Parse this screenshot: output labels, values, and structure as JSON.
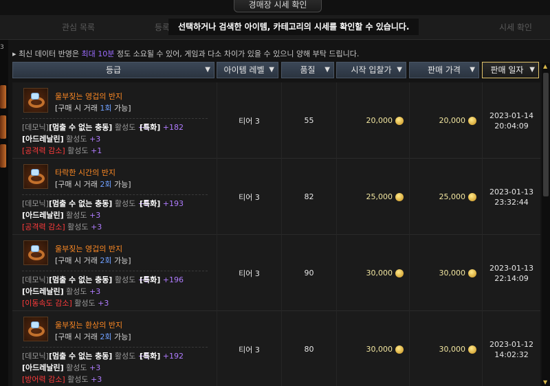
{
  "window": {
    "title": "경매장 시세 확인"
  },
  "tabs": [
    {
      "label": "관심 목록"
    },
    {
      "label": "등록"
    },
    {
      "label": "시세 확인"
    }
  ],
  "tooltip": "선택하거나 검색한 아이템, 카테고리의 시세를 확인할 수 있습니다.",
  "notice": {
    "prefix": "최신 데이터 반영은 ",
    "highlight": "최대 10분",
    "suffix": " 정도 소요될 수 있어, 게임과 다소 차이가 있을 수 있으니 양해 부탁 드립니다."
  },
  "columns": {
    "grade": "등급",
    "item_level": "아이템 레벨",
    "quality": "품질",
    "start_bid": "시작 입찰가",
    "sale_price": "판매 가격",
    "sale_date": "판매 일자"
  },
  "rows": [
    {
      "name": "울부짖는 영겁의 반지",
      "trade_prefix": "[구매 시 거래 ",
      "trade_count": "1회",
      "trade_suffix": " 가능]",
      "engr1_tag": "[데모닉]",
      "engr1_name": "[멈출 수 없는 충동]",
      "engr1_label": " 활성도 ",
      "engr1_val": "+5",
      "stat_name": "[특화]",
      "stat_val": " +182",
      "engr2_name": "[아드레날린]",
      "engr2_label": " 활성도 ",
      "engr2_val": "+3",
      "engr3_name": "[공격력 감소]",
      "engr3_label": " 활성도 ",
      "engr3_val": "+1",
      "tier": "티어 3",
      "quality": "55",
      "start_bid": "20,000",
      "sale_price": "20,000",
      "date": "2023-01-14",
      "time": "20:04:09"
    },
    {
      "name": "타락한 시간의 반지",
      "trade_prefix": "[구매 시 거래 ",
      "trade_count": "2회",
      "trade_suffix": " 가능]",
      "engr1_tag": "[데모닉]",
      "engr1_name": "[멈출 수 없는 충동]",
      "engr1_label": " 활성도 ",
      "engr1_val": "+5",
      "stat_name": "[특화]",
      "stat_val": " +193",
      "engr2_name": "[아드레날린]",
      "engr2_label": " 활성도 ",
      "engr2_val": "+3",
      "engr3_name": "[공격력 감소]",
      "engr3_label": " 활성도 ",
      "engr3_val": "+3",
      "tier": "티어 3",
      "quality": "82",
      "start_bid": "25,000",
      "sale_price": "25,000",
      "date": "2023-01-13",
      "time": "23:32:44"
    },
    {
      "name": "울부짖는 영겁의 반지",
      "trade_prefix": "[구매 시 거래 ",
      "trade_count": "2회",
      "trade_suffix": " 가능]",
      "engr1_tag": "[데모닉]",
      "engr1_name": "[멈출 수 없는 충동]",
      "engr1_label": " 활성도 ",
      "engr1_val": "+5",
      "stat_name": "[특화]",
      "stat_val": " +196",
      "engr2_name": "[아드레날린]",
      "engr2_label": " 활성도 ",
      "engr2_val": "+3",
      "engr3_name": "[이동속도 감소]",
      "engr3_label": " 활성도 ",
      "engr3_val": "+3",
      "tier": "티어 3",
      "quality": "90",
      "start_bid": "30,000",
      "sale_price": "30,000",
      "date": "2023-01-13",
      "time": "22:14:09"
    },
    {
      "name": "울부짖는 환상의 반지",
      "trade_prefix": "[구매 시 거래 ",
      "trade_count": "2회",
      "trade_suffix": " 가능]",
      "engr1_tag": "[데모닉]",
      "engr1_name": "[멈출 수 없는 충동]",
      "engr1_label": " 활성도 ",
      "engr1_val": "+5",
      "stat_name": "[특화]",
      "stat_val": " +192",
      "engr2_name": "[아드레날린]",
      "engr2_label": " 활성도 ",
      "engr2_val": "+3",
      "engr3_name": "[방어력 감소]",
      "engr3_label": " 활성도 ",
      "engr3_val": "+3",
      "tier": "티어 3",
      "quality": "80",
      "start_bid": "30,000",
      "sale_price": "30,000",
      "date": "2023-01-12",
      "time": "14:02:32"
    }
  ]
}
